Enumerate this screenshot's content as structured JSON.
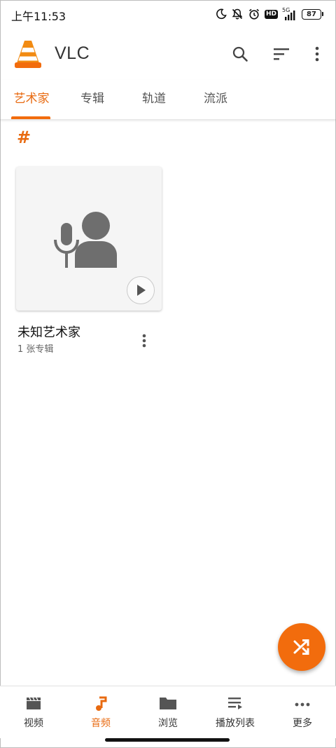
{
  "status_bar": {
    "time": "上午11:53",
    "network_label": "5G",
    "hd_label": "HD",
    "battery": "87",
    "icons": [
      "moon-icon",
      "mute-icon",
      "alarm-icon",
      "hd-icon",
      "signal-icon",
      "battery-icon"
    ]
  },
  "toolbar": {
    "app_name": "VLC",
    "icons": [
      "search-icon",
      "sort-icon",
      "more-vert-icon"
    ]
  },
  "tabs": [
    {
      "label": "艺术家",
      "active": true
    },
    {
      "label": "专辑",
      "active": false
    },
    {
      "label": "轨道",
      "active": false
    },
    {
      "label": "流派",
      "active": false
    }
  ],
  "section": {
    "letter": "#"
  },
  "artist_card": {
    "title": "未知艺术家",
    "subtitle": "1 张专辑"
  },
  "fab": {
    "icon": "shuffle-icon"
  },
  "bottom_nav": [
    {
      "label": "视频",
      "icon": "clapperboard-icon",
      "active": false
    },
    {
      "label": "音频",
      "icon": "music-note-icon",
      "active": true
    },
    {
      "label": "浏览",
      "icon": "folder-icon",
      "active": false
    },
    {
      "label": "播放列表",
      "icon": "playlist-icon",
      "active": false
    },
    {
      "label": "更多",
      "icon": "more-horiz-icon",
      "active": false
    }
  ],
  "colors": {
    "accent": "#f26c0d",
    "accent_text": "#e86a10",
    "icon_gray": "#6e6e6e"
  }
}
